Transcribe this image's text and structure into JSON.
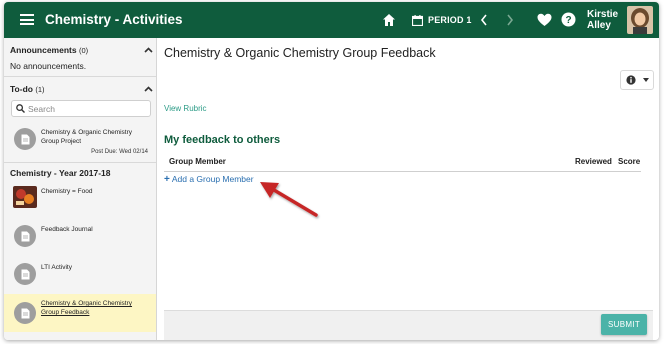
{
  "header": {
    "title": "Chemistry - Activities",
    "period_label": "PERIOD 1",
    "user_name_line1": "Kirstie",
    "user_name_line2": "Alley",
    "bar_color": "#0f5c3d"
  },
  "sidebar": {
    "announcements": {
      "title": "Announcements",
      "count": "(0)",
      "empty_text": "No announcements."
    },
    "todo": {
      "title": "To-do",
      "count": "(1)",
      "search_placeholder": "Search",
      "items": [
        {
          "label": "Chemistry & Organic Chemistry Group Project",
          "due": "Post Due: Wed 02/14",
          "icon": "document-icon"
        }
      ]
    },
    "course": {
      "title": "Chemistry - Year 2017-18",
      "items": [
        {
          "label": "Chemistry = Food",
          "icon": "food-thumbnail"
        },
        {
          "label": "Feedback Journal",
          "icon": "document-icon"
        },
        {
          "label": "LTI Activity",
          "icon": "document-icon"
        },
        {
          "label": "Chemistry & Organic Chemistry Group Feedback",
          "icon": "document-icon",
          "active": true
        }
      ]
    }
  },
  "main": {
    "title": "Chemistry & Organic Chemistry Group Feedback",
    "view_rubric": "View Rubric",
    "section_title": "My feedback to others",
    "columns": [
      "Group Member",
      "Reviewed",
      "Score"
    ],
    "add_member": "Add a Group Member",
    "submit": "SUBMIT",
    "accent_color": "#4bb3a8",
    "annotation_color": "#c62828"
  }
}
